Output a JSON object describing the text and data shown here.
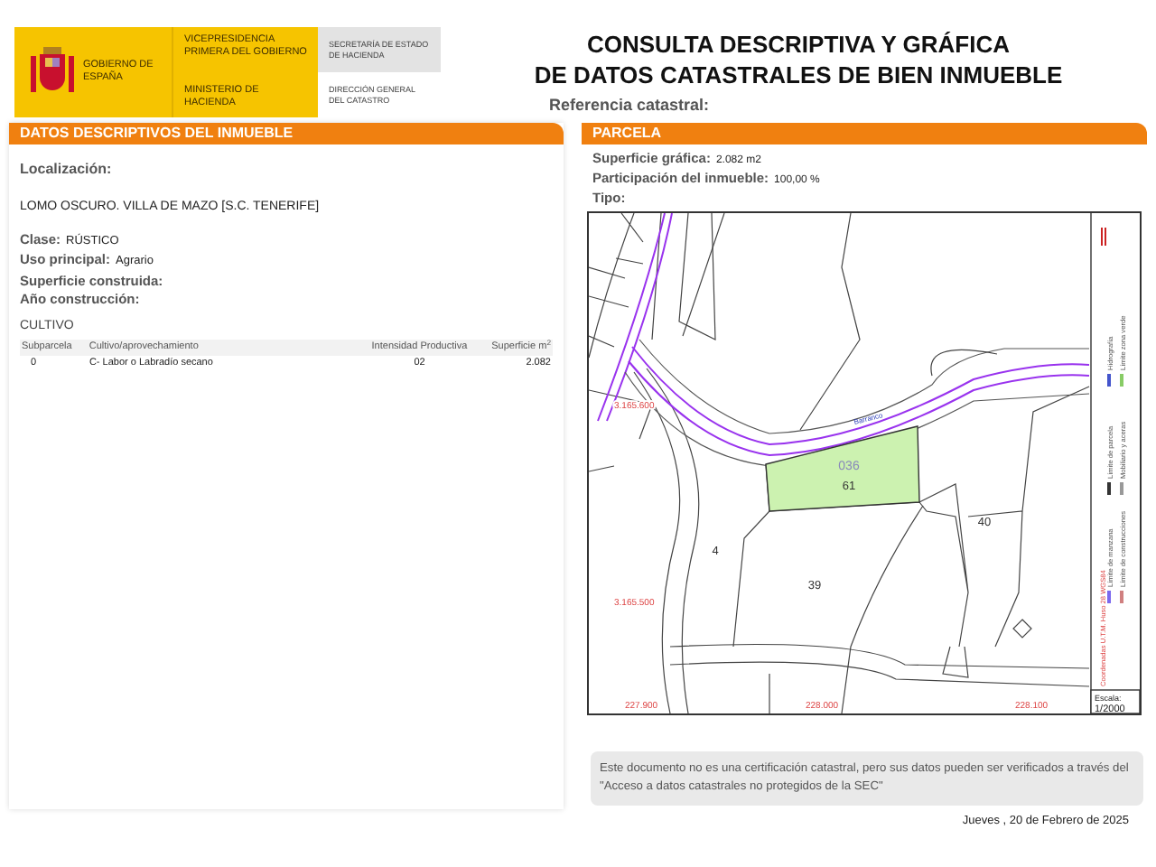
{
  "header": {
    "government": "GOBIERNO DE ESPAÑA",
    "vicepresidency": "VICEPRESIDENCIA PRIMERA DEL GOBIERNO",
    "ministry": "MINISTERIO DE HACIENDA",
    "secretariat": "SECRETARÍA DE ESTADO DE HACIENDA",
    "directorate": "DIRECCIÓN GENERAL DEL CATASTRO"
  },
  "title": [
    "CONSULTA DESCRIPTIVA Y GRÁFICA",
    "DE DATOS CATASTRALES DE BIEN INMUEBLE"
  ],
  "reference_label": "Referencia catastral:",
  "property": {
    "heading": "DATOS DESCRIPTIVOS DEL INMUEBLE",
    "location_label": "Localización:",
    "address": "LOMO OSCURO. VILLA DE MAZO [S.C. TENERIFE]",
    "fields": [
      {
        "label": "Clase:",
        "value": "RÚSTICO"
      },
      {
        "label": "Uso principal:",
        "value": "Agrario"
      },
      {
        "label": "Superficie construida:"
      },
      {
        "label": "Año construcción:"
      }
    ],
    "crops_heading": "CULTIVO",
    "table": {
      "columns": [
        "Subparcela",
        "Cultivo/aprovechamiento",
        "Intensidad Productiva",
        "Superficie m$^{2}$"
      ],
      "rows": [
        [
          "0",
          "C- Labor o Labradío secano",
          "02",
          "2.082"
        ]
      ]
    }
  },
  "parcel": {
    "heading": "PARCELA",
    "fields": [
      {
        "label": "Superficie gráfica:",
        "value": "2.082 m2"
      },
      {
        "label": "Participación del inmueble:",
        "value": "100,00 %"
      },
      {
        "label": "Tipo:"
      }
    ],
    "map": {
      "labels": [
        {
          "kind": "parcel_code",
          "text": "036"
        },
        {
          "kind": "parcel_number",
          "text": "61"
        },
        {
          "kind": "parcel_number",
          "text": "4"
        },
        {
          "kind": "parcel_number",
          "text": "39"
        },
        {
          "kind": "parcel_number",
          "text": "40"
        },
        {
          "kind": "street",
          "text": "Barranco"
        },
        {
          "kind": "coordinate",
          "text": "3.165.600"
        },
        {
          "kind": "coordinate",
          "text": "3.165.500"
        },
        {
          "kind": "coordinate",
          "text": "227.900"
        },
        {
          "kind": "coordinate",
          "text": "228.000"
        },
        {
          "kind": "coordinate",
          "text": "228.100"
        }
      ],
      "legend": [
        {
          "label": "Límite de manzana",
          "color": "#7b68ee"
        },
        {
          "label": "Límite de parcela",
          "color": "#333333"
        },
        {
          "label": "Hidrografía",
          "color": "#4455cc"
        },
        {
          "label": "Límite de construcciones",
          "color": "#d08080"
        },
        {
          "label": "Mobiliario y aceras",
          "color": "#999999"
        },
        {
          "label": "Límite zona verde",
          "color": "#88cc66"
        }
      ],
      "projection": "Coordenadas U.T.M. Huso 28 WGS84",
      "scale_label": "Escala:",
      "scale": "1/2000"
    }
  },
  "notice": "Este documento no es una certificación catastral, pero sus datos pueden ser verificados a través del \"Acceso a datos catastrales no protegidos de la SEC\"",
  "date": "Jueves , 20 de Febrero de 2025"
}
